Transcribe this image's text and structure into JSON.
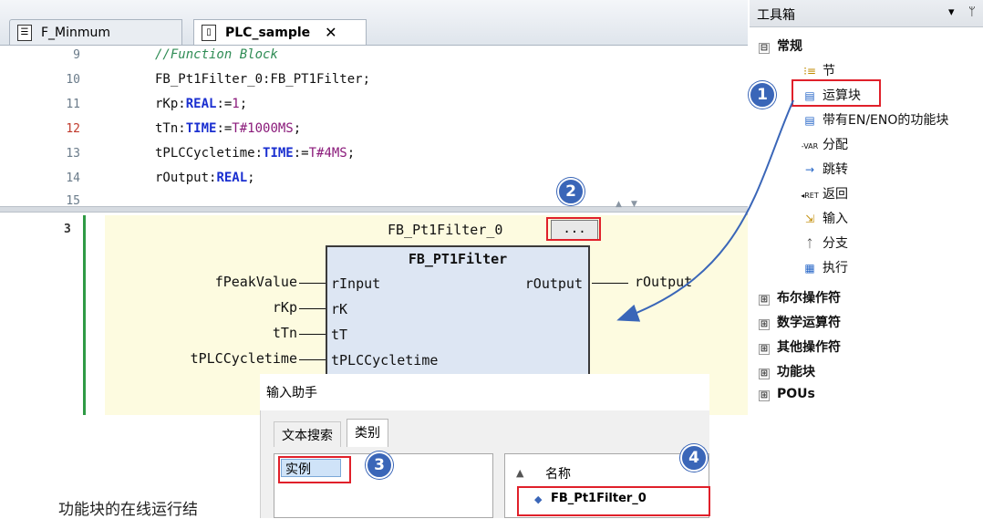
{
  "tabs": [
    {
      "label": "F_Minmum"
    },
    {
      "label": "PLC_sample",
      "close": "✕"
    }
  ],
  "declaration": {
    "lines": [
      {
        "num": "9",
        "text": "//Function Block"
      },
      {
        "num": "10",
        "text": "FB_Pt1Filter_0:FB_PT1Filter;"
      },
      {
        "num": "11",
        "text": "rKp:REAL:=1;"
      },
      {
        "num": "12",
        "text": "tTn:TIME:=T#1000MS;"
      },
      {
        "num": "13",
        "text": "tPLCCycletime:TIME:=T#4MS;"
      },
      {
        "num": "14",
        "text": "rOutput:REAL;"
      },
      {
        "num": "15",
        "text": ""
      }
    ]
  },
  "fbd": {
    "network_num": "3",
    "instance_name": "FB_Pt1Filter_0",
    "ellipsis_button": "...",
    "fb_type": "FB_PT1Filter",
    "inputs": [
      {
        "external": "fPeakValue",
        "pin": "rInput"
      },
      {
        "external": "rKp",
        "pin": "rK"
      },
      {
        "external": "tTn",
        "pin": "tT"
      },
      {
        "external": "tPLCCycletime",
        "pin": "tPLCCycletime"
      }
    ],
    "output_pin": "rOutput",
    "output_external": "rOutput"
  },
  "toolbox": {
    "title": "工具箱",
    "dropdown_icon": "▾",
    "pin_icon": "ᛘ",
    "general_group": "常规",
    "general_items": [
      {
        "icon": "节",
        "label": "节"
      },
      {
        "icon": "box",
        "label": "运算块"
      },
      {
        "icon": "box-en",
        "label": "带有EN/ENO的功能块"
      },
      {
        "icon": "VAR",
        "label": "分配"
      },
      {
        "icon": "→",
        "label": "跳转"
      },
      {
        "icon": "RET",
        "label": "返回"
      },
      {
        "icon": "input",
        "label": "输入"
      },
      {
        "icon": "branch",
        "label": "分支"
      },
      {
        "icon": "exec",
        "label": "执行"
      }
    ],
    "collapsed_groups": [
      "布尔操作符",
      "数学运算符",
      "其他操作符",
      "功能块",
      "POUs"
    ],
    "expanded_mark": "⊟",
    "collapsed_mark": "⊞"
  },
  "input_assistant": {
    "title": "输入助手",
    "tabs": [
      "文本搜索",
      "类别"
    ],
    "category_item": "实例",
    "column_header": "名称",
    "result_item": "FB_Pt1Filter_0"
  },
  "caption_text": "功能块的在线运行结",
  "badges": [
    "1",
    "2",
    "3",
    "4"
  ],
  "colors": {
    "accent_red": "#e0202a",
    "badge_blue": "#3a66b8",
    "keyword_blue": "#1a2fd0",
    "comment_green": "#2f8c55",
    "fbd_background": "#fdfbe0",
    "fb_box": "#dde6f3"
  }
}
